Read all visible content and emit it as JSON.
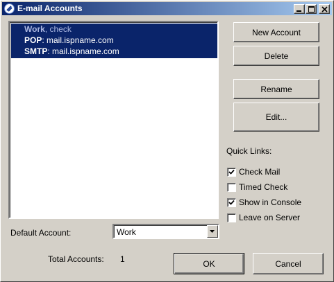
{
  "window": {
    "title": "E-mail Accounts",
    "controls": [
      "minimize-icon",
      "maximize-icon",
      "close-icon"
    ]
  },
  "accounts_list": {
    "selected_item": {
      "name": "Work",
      "name_suffix": ", check",
      "pop_label": "POP",
      "pop_value": ": mail.ispname.com",
      "smtp_label": "SMTP",
      "smtp_value": ": mail.ispname.com"
    }
  },
  "buttons": {
    "new_account": "New Account",
    "delete": "Delete",
    "rename": "Rename",
    "edit": "Edit...",
    "ok": "OK",
    "cancel": "Cancel"
  },
  "quick_links": {
    "heading": "Quick Links:",
    "items": [
      {
        "label": "Check Mail",
        "checked": true
      },
      {
        "label": "Timed Check",
        "checked": false
      },
      {
        "label": "Show in Console",
        "checked": true
      },
      {
        "label": "Leave on Server",
        "checked": false
      }
    ]
  },
  "default_account": {
    "label": "Default Account:",
    "value": "Work"
  },
  "total_accounts": {
    "label": "Total Accounts:",
    "value": "1"
  },
  "colors": {
    "selection": "#0a246a",
    "dialog_bg": "#d4d0c8"
  }
}
